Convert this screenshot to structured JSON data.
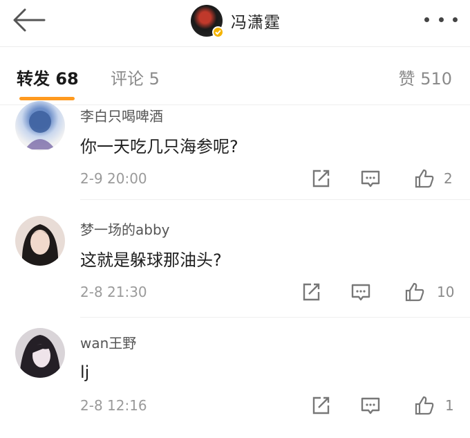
{
  "header": {
    "title": "冯潇霆",
    "back_icon": "back-arrow-icon",
    "more_icon": "more-dots-icon",
    "verified_badge_color": "#f5b400"
  },
  "tabs": {
    "reposts": {
      "label": "转发",
      "count": "68"
    },
    "comments": {
      "label": "评论",
      "count": "5"
    },
    "likes": {
      "label": "赞",
      "count": "510"
    },
    "accent_color": "#ff9a1f"
  },
  "comments": [
    {
      "user": "李白只喝啤酒",
      "text": "你一天吃几只海参呢?",
      "time": "2-9 20:00",
      "likes": "2"
    },
    {
      "user": "梦一场的abby",
      "text": "这就是躲球那油头?",
      "time": "2-8 21:30",
      "likes": "10"
    },
    {
      "user": "wan王野",
      "text": "lj",
      "time": "2-8 12:16",
      "likes": "1"
    }
  ],
  "icons": {
    "repost": "share-square-icon",
    "reply": "comment-bubble-icon",
    "like": "thumbs-up-icon"
  }
}
